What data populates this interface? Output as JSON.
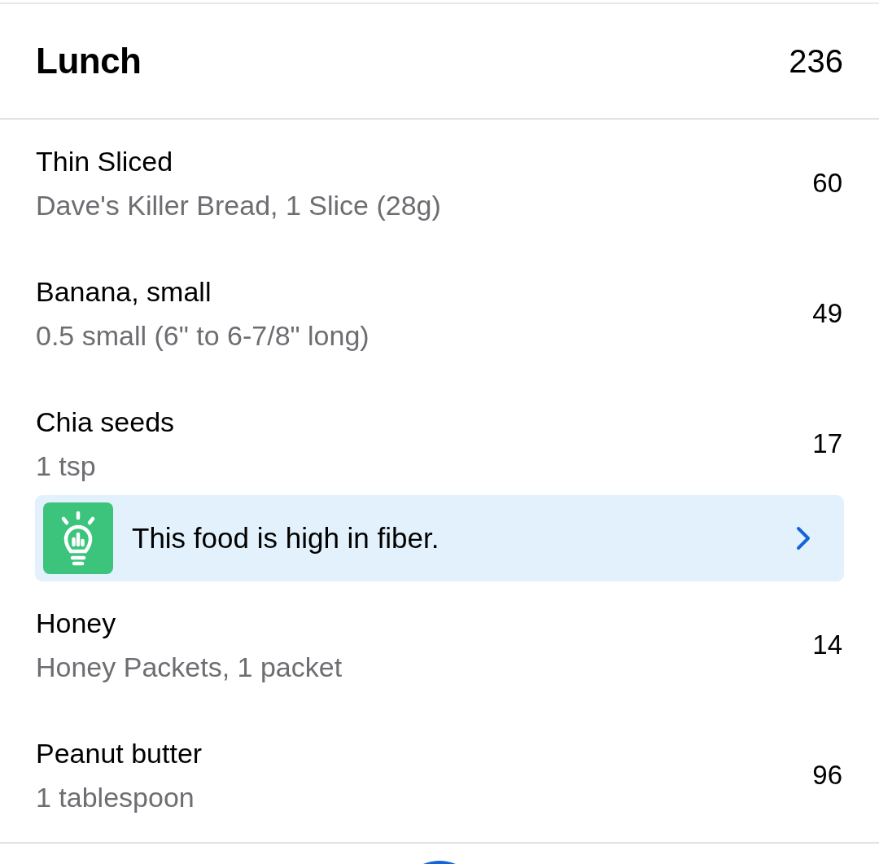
{
  "meal": {
    "title": "Lunch",
    "calories": "236"
  },
  "foods": [
    {
      "name": "Thin Sliced",
      "serving": "Dave's Killer Bread, 1 Slice (28g)",
      "calories": "60"
    },
    {
      "name": "Banana, small",
      "serving": "0.5 small (6\" to 6-7/8\" long)",
      "calories": "49"
    },
    {
      "name": "Chia seeds",
      "serving": "1 tsp",
      "calories": "17",
      "tip": {
        "text": "This food is high in fiber."
      }
    },
    {
      "name": "Honey",
      "serving": "Honey Packets, 1 packet",
      "calories": "14"
    },
    {
      "name": "Peanut butter",
      "serving": "1 tablespoon",
      "calories": "96"
    }
  ]
}
